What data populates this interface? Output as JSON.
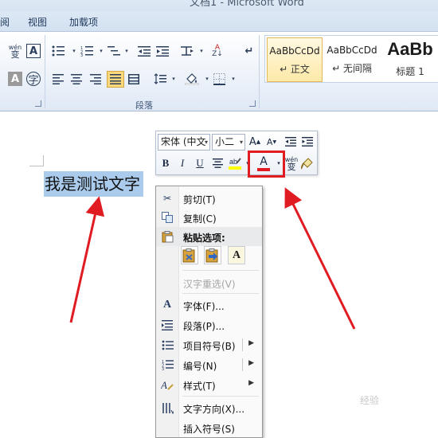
{
  "window": {
    "title": "文档1 - Microsoft Word"
  },
  "ribbon": {
    "tabs": [
      "阅",
      "视图",
      "加载项"
    ],
    "paragraph_group_label": "段落",
    "styles": [
      {
        "sample": "AaBbCcDd",
        "name": "↵ 正文",
        "active": true
      },
      {
        "sample": "AaBbCcDd",
        "name": "↵ 无间隔",
        "active": false
      },
      {
        "sample": "AaBb",
        "name": "标题 1",
        "active": false
      }
    ],
    "phonetic_glyph": "wén\n变",
    "char_border_glyph": "A",
    "shade_glyph": "A",
    "enclose_glyph": "字"
  },
  "document": {
    "selected_text": "我是测试文字"
  },
  "mini_toolbar": {
    "font_name": "宋体 (中文",
    "font_size": "小二",
    "grow_font": "A",
    "shrink_font": "A",
    "bold": "B",
    "italic": "I",
    "underline": "U",
    "font_color_glyph": "A",
    "font_color": "#e01b22",
    "phonetic": "wén"
  },
  "context_menu": {
    "items": [
      {
        "label": "剪切(T)",
        "icon": "scissors-icon"
      },
      {
        "label": "复制(C)",
        "icon": "copy-icon"
      },
      {
        "label": "粘贴选项:",
        "icon": "clipboard-icon"
      },
      {
        "label": "汉字重选(V)",
        "icon": "",
        "disabled": true
      },
      {
        "label": "字体(F)...",
        "icon": "font-icon"
      },
      {
        "label": "段落(P)...",
        "icon": "paragraph-icon"
      },
      {
        "label": "项目符号(B)",
        "icon": "bullets-icon",
        "submenu": true
      },
      {
        "label": "编号(N)",
        "icon": "numbering-icon",
        "submenu": true
      },
      {
        "label": "样式(T)",
        "icon": "styles-icon",
        "submenu": true
      },
      {
        "label": "文字方向(X)...",
        "icon": "text-direction-icon"
      },
      {
        "label": "插入符号(S)",
        "icon": ""
      }
    ],
    "paste_option_text_glyph": "A",
    "submenu_arrow": "▶"
  },
  "colors": {
    "accent_red": "#e01b22",
    "selection": "#aacbec"
  },
  "watermark": "经验"
}
